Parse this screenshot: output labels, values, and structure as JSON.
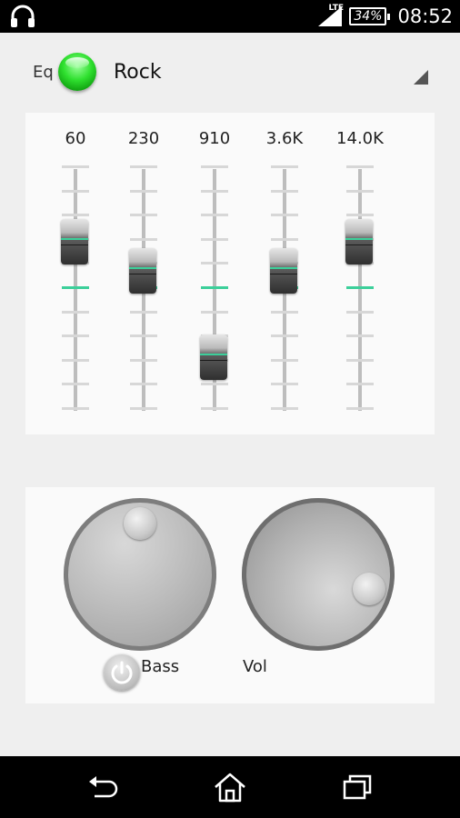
{
  "status_bar": {
    "network": "LTE",
    "battery": "34%",
    "time": "08:52"
  },
  "header": {
    "eq_label": "Eq",
    "preset": "Rock"
  },
  "equalizer": {
    "bands": [
      {
        "label": "60",
        "level": 0.7
      },
      {
        "label": "230",
        "level": 0.58
      },
      {
        "label": "910",
        "level": 0.22
      },
      {
        "label": "3.6K",
        "level": 0.58
      },
      {
        "label": "14.0K",
        "level": 0.7
      }
    ]
  },
  "controls": {
    "bass_label": "Bass",
    "vol_label": "Vol"
  },
  "colors": {
    "accent_green": "#2fe02f",
    "zero_line": "#3ccf9a"
  },
  "icons": {
    "status": "headphones-icon",
    "nav": [
      "back-icon",
      "home-icon",
      "recents-icon"
    ]
  }
}
